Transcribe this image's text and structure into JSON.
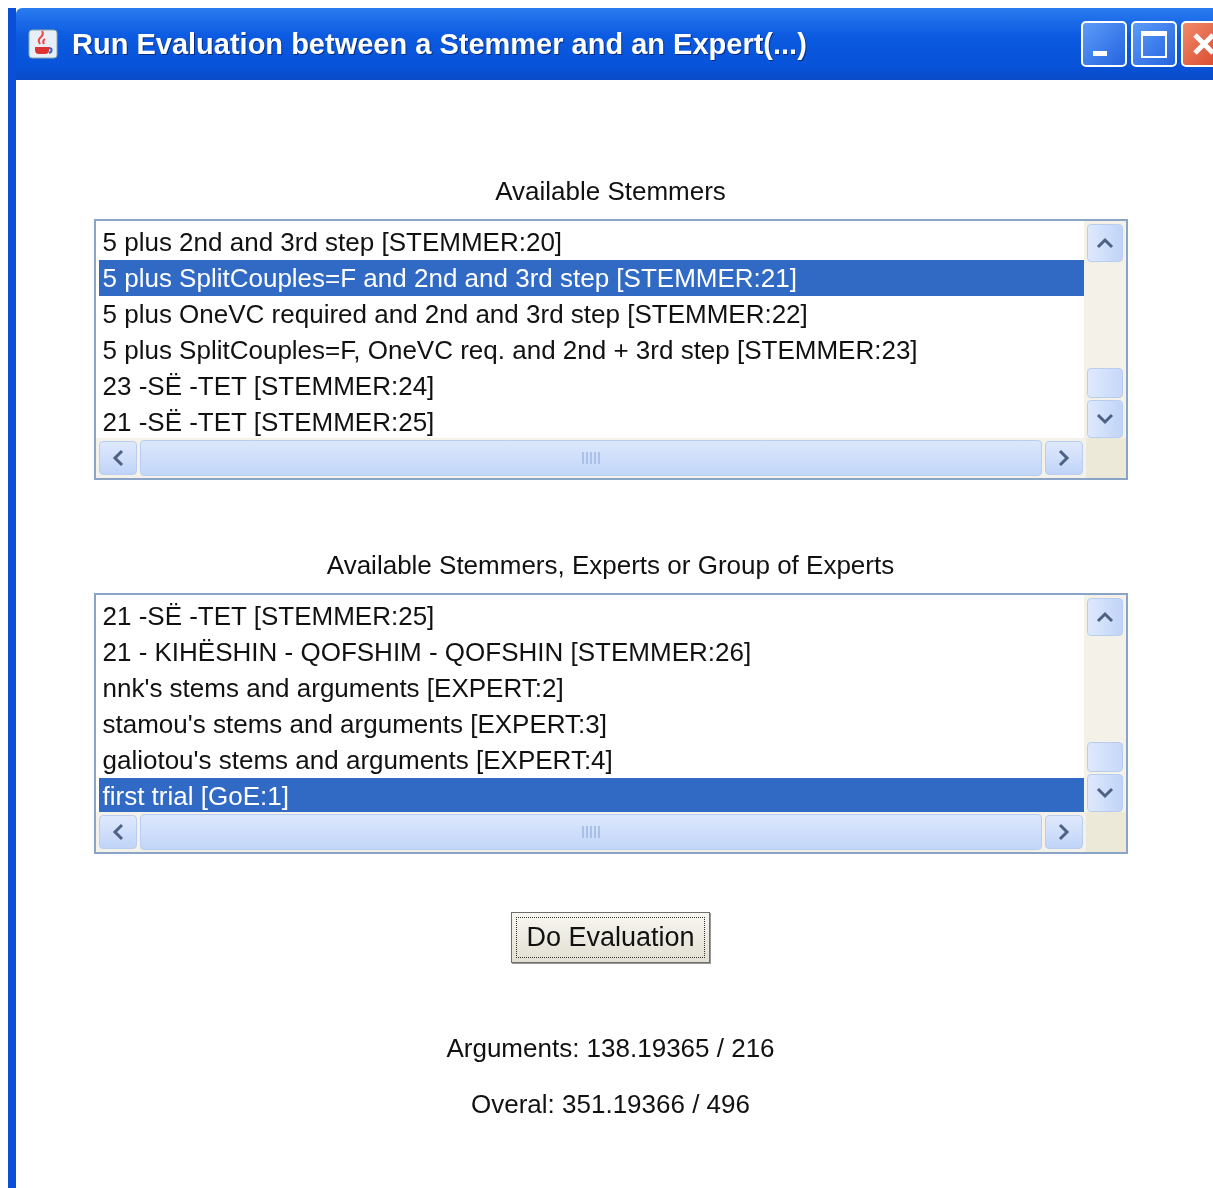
{
  "window": {
    "title": "Run Evaluation between a Stemmer and an Expert(...)"
  },
  "lists": [
    {
      "label": "Available Stemmers",
      "items": [
        {
          "text": "5 plus 2nd and 3rd step [STEMMER:20]",
          "selected": false
        },
        {
          "text": "5 plus SplitCouples=F and 2nd and 3rd step [STEMMER:21]",
          "selected": true
        },
        {
          "text": "5 plus OneVC required and 2nd and 3rd step [STEMMER:22]",
          "selected": false
        },
        {
          "text": "5 plus SplitCouples=F, OneVC req. and 2nd + 3rd step [STEMMER:23]",
          "selected": false
        },
        {
          "text": "23 -SË -TET [STEMMER:24]",
          "selected": false
        },
        {
          "text": "21 -SË -TET [STEMMER:25]",
          "selected": false
        }
      ]
    },
    {
      "label": "Available Stemmers, Experts or Group of Experts",
      "items": [
        {
          "text": "21 -SË -TET [STEMMER:25]",
          "selected": false
        },
        {
          "text": "21 - KIHËSHIN - QOFSHIM - QOFSHIN [STEMMER:26]",
          "selected": false
        },
        {
          "text": "nnk's stems and arguments [EXPERT:2]",
          "selected": false
        },
        {
          "text": "stamou's stems and arguments [EXPERT:3]",
          "selected": false
        },
        {
          "text": "galiotou's stems and arguments [EXPERT:4]",
          "selected": false
        },
        {
          "text": "first trial [GoE:1]",
          "selected": true
        }
      ]
    }
  ],
  "button": "Do Evaluation",
  "results": [
    "Arguments: 138.19365 / 216",
    "Overal: 351.19366 / 496"
  ]
}
